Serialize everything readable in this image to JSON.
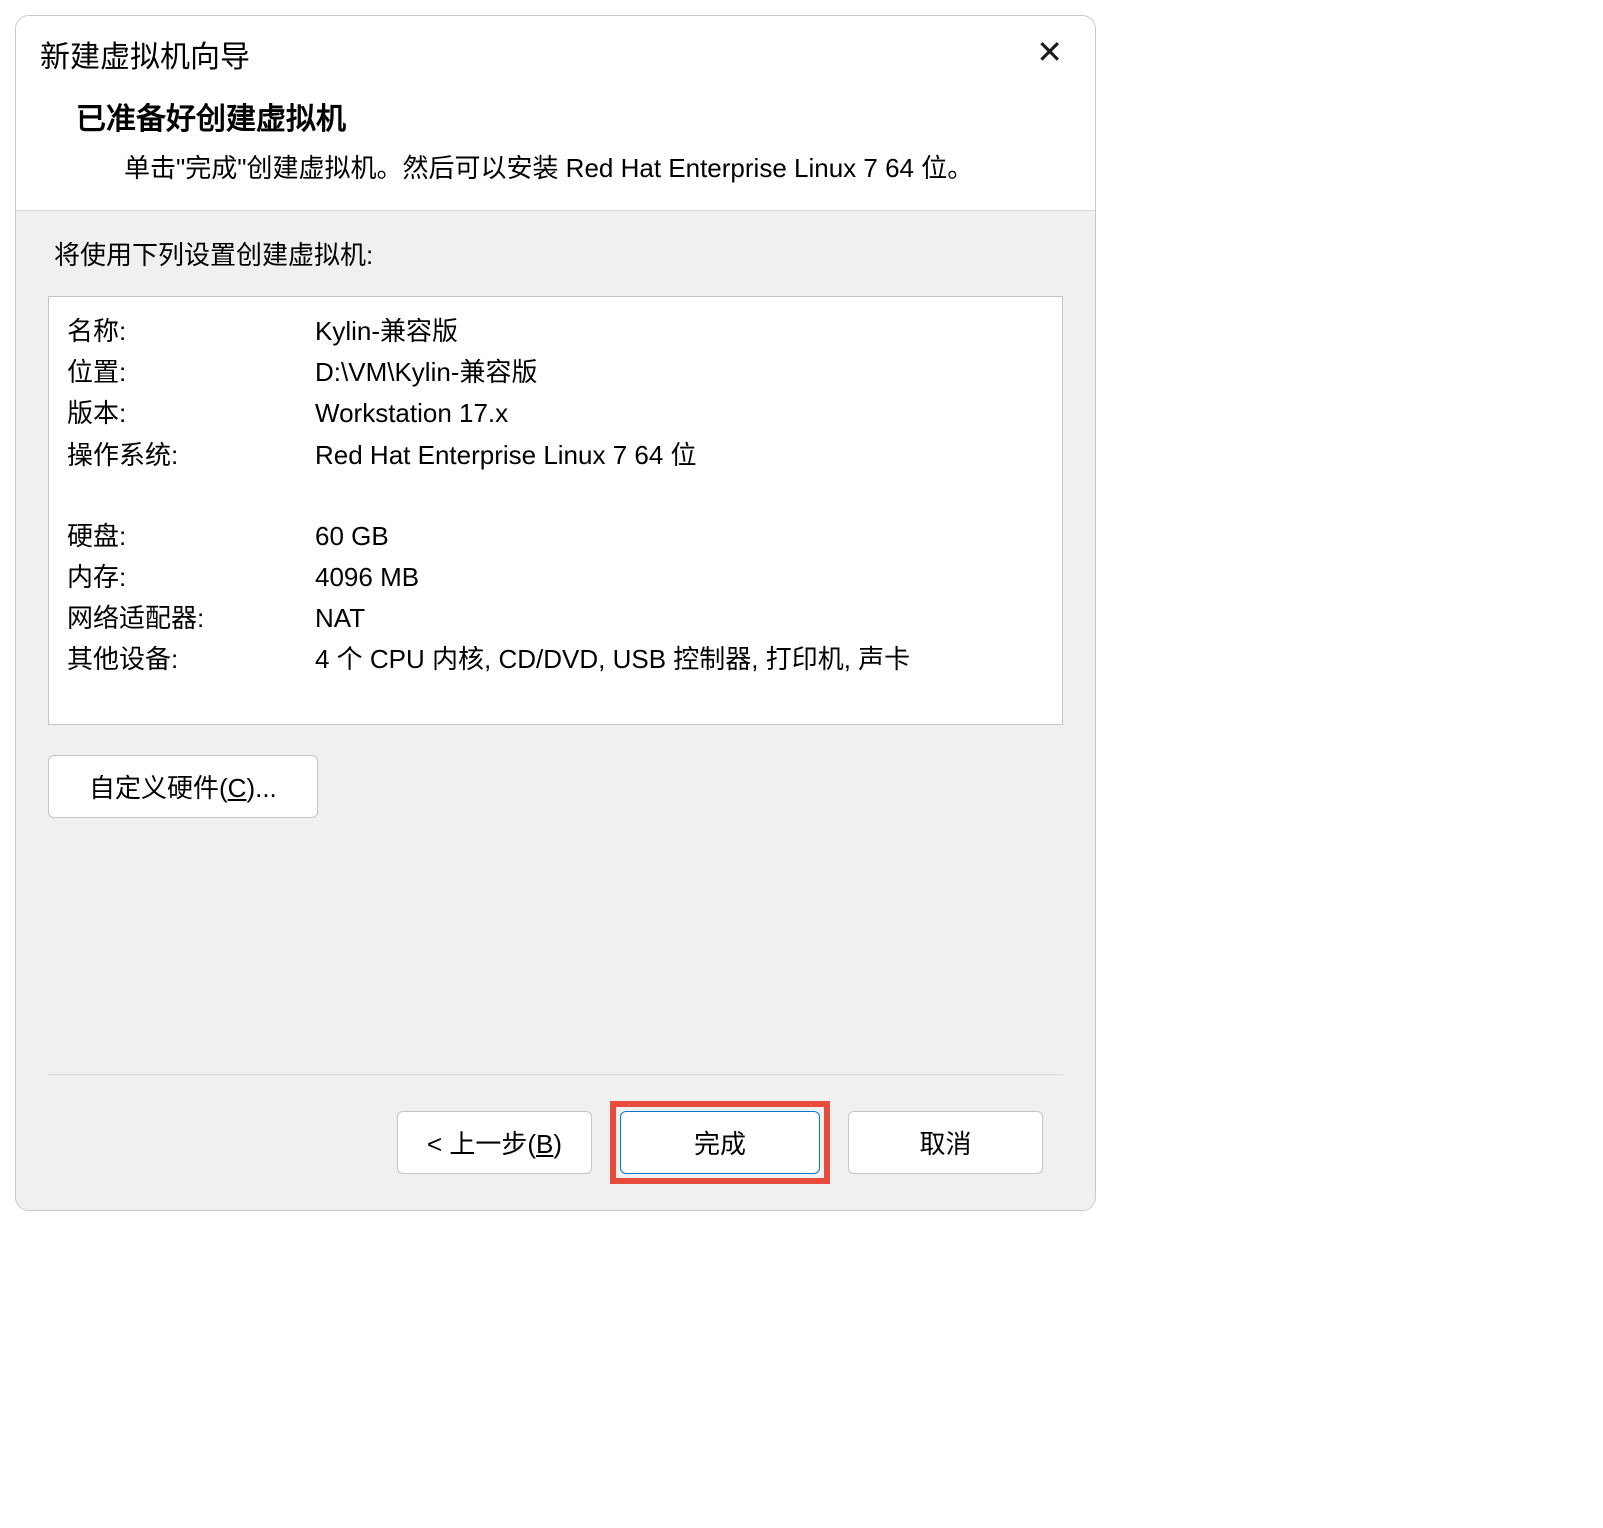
{
  "title_bar": {
    "title": "新建虚拟机向导"
  },
  "header": {
    "title": "已准备好创建虚拟机",
    "subtitle": "单击\"完成\"创建虚拟机。然后可以安装 Red Hat Enterprise Linux 7 64 位。"
  },
  "settings_intro": "将使用下列设置创建虚拟机:",
  "settings": {
    "name_label": "名称:",
    "name_value": "Kylin-兼容版",
    "location_label": "位置:",
    "location_value": "D:\\VM\\Kylin-兼容版",
    "version_label": "版本:",
    "version_value": "Workstation 17.x",
    "os_label": "操作系统:",
    "os_value": "Red Hat Enterprise Linux 7 64 位",
    "disk_label": "硬盘:",
    "disk_value": "60 GB",
    "memory_label": "内存:",
    "memory_value": "4096 MB",
    "network_label": "网络适配器:",
    "network_value": "NAT",
    "other_label": "其他设备:",
    "other_value": "4 个 CPU 内核, CD/DVD, USB 控制器, 打印机, 声卡"
  },
  "buttons": {
    "customize_pre": "自定义硬件(",
    "customize_key": "C",
    "customize_post": ")...",
    "back_pre": "< 上一步(",
    "back_key": "B",
    "back_post": ")",
    "finish": "完成",
    "cancel": "取消"
  }
}
